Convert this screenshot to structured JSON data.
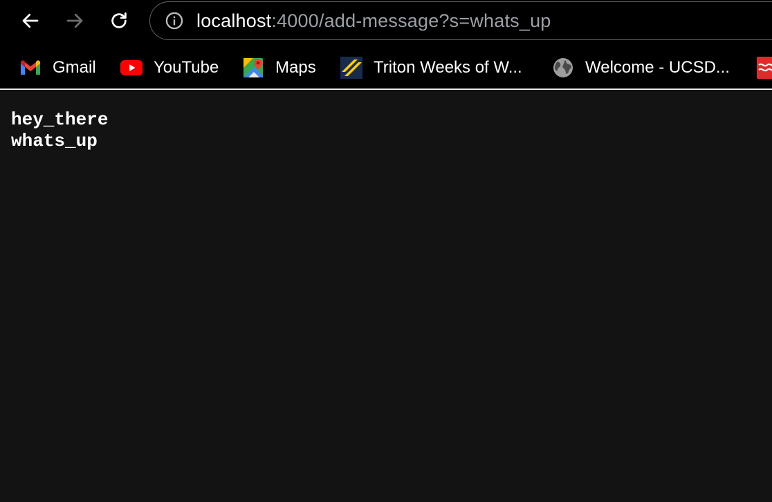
{
  "browser": {
    "address_bar": {
      "url_host": "localhost",
      "url_rest": ":4000/add-message?s=whats_up"
    },
    "bookmarks": [
      {
        "label": "Gmail",
        "icon": "gmail-icon"
      },
      {
        "label": "YouTube",
        "icon": "youtube-icon"
      },
      {
        "label": "Maps",
        "icon": "maps-icon"
      },
      {
        "label": "Triton Weeks of W...",
        "icon": "triton-icon"
      },
      {
        "label": "Welcome - UCSD...",
        "icon": "globe-icon"
      },
      {
        "label": "",
        "icon": "bookmark-icon"
      }
    ]
  },
  "page": {
    "lines": [
      "hey_there",
      "whats_up"
    ]
  },
  "colors": {
    "toolbar_bg": "#000000",
    "page_bg": "#131313",
    "text": "#ffffff",
    "url_muted": "#9aa0a6"
  }
}
